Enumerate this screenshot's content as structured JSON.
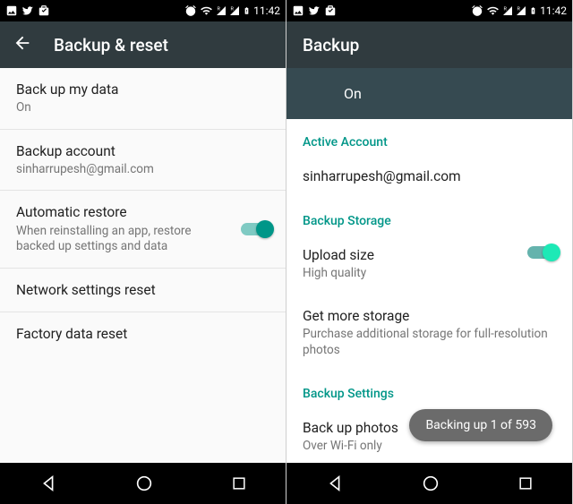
{
  "status": {
    "time": "11:42"
  },
  "left": {
    "title": "Backup & reset",
    "items": {
      "backup_data": {
        "title": "Back up my data",
        "sub": "On"
      },
      "backup_account": {
        "title": "Backup account",
        "sub": "sinharrupesh@gmail.com"
      },
      "auto_restore": {
        "title": "Automatic restore",
        "sub": "When reinstalling an app, restore backed up settings and data"
      },
      "network_reset": {
        "title": "Network settings reset"
      },
      "factory_reset": {
        "title": "Factory data reset"
      }
    }
  },
  "right": {
    "title": "Backup",
    "toggle_label": "On",
    "sections": {
      "active_account": "Active Account",
      "backup_storage": "Backup Storage",
      "backup_settings": "Backup Settings"
    },
    "items": {
      "account": {
        "title": "sinharrupesh@gmail.com"
      },
      "upload_size": {
        "title": "Upload size",
        "sub": "High quality"
      },
      "more_storage": {
        "title": "Get more storage",
        "sub": "Purchase additional storage for full-resolution photos"
      },
      "backup_photos": {
        "title": "Back up photos",
        "sub": "Over Wi-Fi only"
      }
    },
    "toast": "Backing up 1 of 593"
  }
}
